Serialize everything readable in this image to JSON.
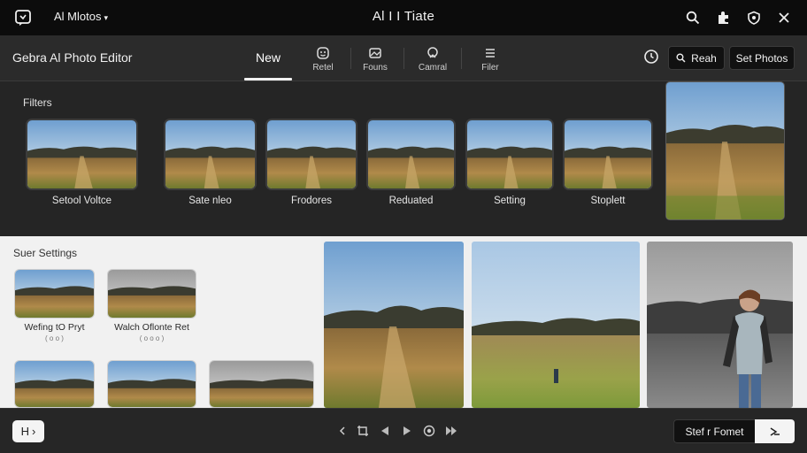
{
  "topbar": {
    "app_switcher": "Al Mlotos",
    "window_title": "Al I I Tiate",
    "icons": [
      "app-logo-icon",
      "search-icon",
      "puzzle-icon",
      "shield-icon",
      "close-icon"
    ]
  },
  "toolbar": {
    "product_title": "Gebra  Al Photo Editor",
    "active_tab": "New",
    "tools": [
      {
        "label": "Retel",
        "icon": "retouch-icon"
      },
      {
        "label": "Founs",
        "icon": "layers-icon"
      },
      {
        "label": "Camral",
        "icon": "camera-icon"
      },
      {
        "label": "Filer",
        "icon": "filter-icon"
      }
    ],
    "search_button": "Reah",
    "set_photos_button": "Set Photos"
  },
  "filters": {
    "title": "Filters",
    "items": [
      {
        "label": "Setool Voltce"
      },
      {
        "label": "Sate nleo"
      },
      {
        "label": "Frodores"
      },
      {
        "label": "Reduated"
      },
      {
        "label": "Setting"
      },
      {
        "label": "Stoplett"
      }
    ]
  },
  "settings": {
    "title": "Suer Settings",
    "presets": [
      {
        "label": "Wefing tO Pryt",
        "sub": "( o o )"
      },
      {
        "label": "Walch Oflonte Ret",
        "sub": "( o o o )"
      }
    ]
  },
  "bottombar": {
    "h_button": "H",
    "format_button": "Stef r Fomet"
  },
  "colors": {
    "topbar_bg": "#0c0c0c",
    "toolbar_bg": "#2b2b2b",
    "panel_bg": "#252525",
    "light_panel_bg": "#f1f1f1",
    "accent": "#f0f0f0"
  }
}
